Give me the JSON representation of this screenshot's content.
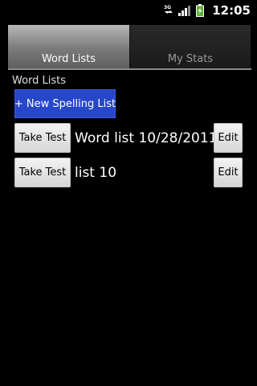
{
  "status_bar": {
    "network": "3G",
    "time": "12:05"
  },
  "tabs": [
    {
      "label": "Word Lists",
      "active": true
    },
    {
      "label": "My Stats",
      "active": false
    }
  ],
  "section_label": "Word Lists",
  "new_list_button": "+ New Spelling List",
  "lists": [
    {
      "take_test": "Take Test",
      "name": "Word list 10/28/2011",
      "edit": "Edit"
    },
    {
      "take_test": "Take Test",
      "name": "list 10",
      "edit": "Edit"
    }
  ],
  "colors": {
    "accent": "#2747c9",
    "background": "#000000"
  }
}
